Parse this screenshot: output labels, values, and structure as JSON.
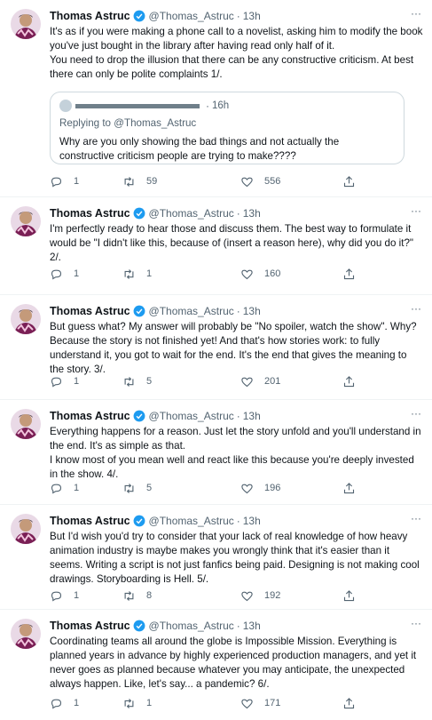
{
  "author": {
    "name": "Thomas Astruc",
    "handle": "@Thomas_Astruc"
  },
  "colors": {
    "verified": "#1d9bf0",
    "icon": "#536471",
    "text": "#0f1419",
    "border": "#cfd9de"
  },
  "tweets": [
    {
      "time": "13h",
      "lines": [
        "It's as if you were making a phone call to a novelist, asking him to modify the book you've just bought in the library after having read only half of it.",
        "You need to drop the illusion that there can be any constructive criticism. At best there can only be polite complaints 1/."
      ],
      "quote": {
        "time": "16h",
        "replying_label": "Replying to",
        "replying_to": "@Thomas_Astruc",
        "text": "Why are you only showing the bad things and not actually the constructive criticism people are trying to make????"
      },
      "replies": "1",
      "retweets": "59",
      "likes": "556"
    },
    {
      "time": "13h",
      "lines": [
        "I'm perfectly ready to hear those and discuss them. The best way to formulate it would be \"I didn't like this, because of (insert a reason here), why did you do it?\" 2/."
      ],
      "replies": "1",
      "retweets": "1",
      "likes": "160"
    },
    {
      "time": "13h",
      "lines": [
        "But guess what? My answer will probably be \"No spoiler, watch the show\". Why? Because the story is not finished yet! And that's how stories work: to fully understand it, you got to wait for the end. It's the end that gives the meaning to the story. 3/."
      ],
      "replies": "1",
      "retweets": "5",
      "likes": "201"
    },
    {
      "time": "13h",
      "lines": [
        "Everything happens for a reason. Just let the story unfold and you'll understand in the end. It's as simple as that.",
        "I know most of you mean well and react like this because you're deeply invested in the show. 4/."
      ],
      "replies": "1",
      "retweets": "5",
      "likes": "196"
    },
    {
      "time": "13h",
      "lines": [
        "But I'd wish you'd try to consider that your lack of real knowledge of how heavy animation industry is maybe makes you wrongly think that it's easier than it seems. Writing a script is  not just fanfics being paid. Designing is not making cool drawings. Storyboarding is Hell. 5/."
      ],
      "replies": "1",
      "retweets": "8",
      "likes": "192"
    },
    {
      "time": "13h",
      "lines": [
        "Coordinating teams all around the globe is Impossible Mission. Everything is planned years in advance by highly experienced production managers, and yet it never goes as planned because whatever you may anticipate, the unexpected always happen. Like, let's say... a pandemic? 6/."
      ],
      "replies": "1",
      "retweets": "1",
      "likes": "171"
    }
  ],
  "ui": {
    "dot": "·",
    "more": "···"
  }
}
